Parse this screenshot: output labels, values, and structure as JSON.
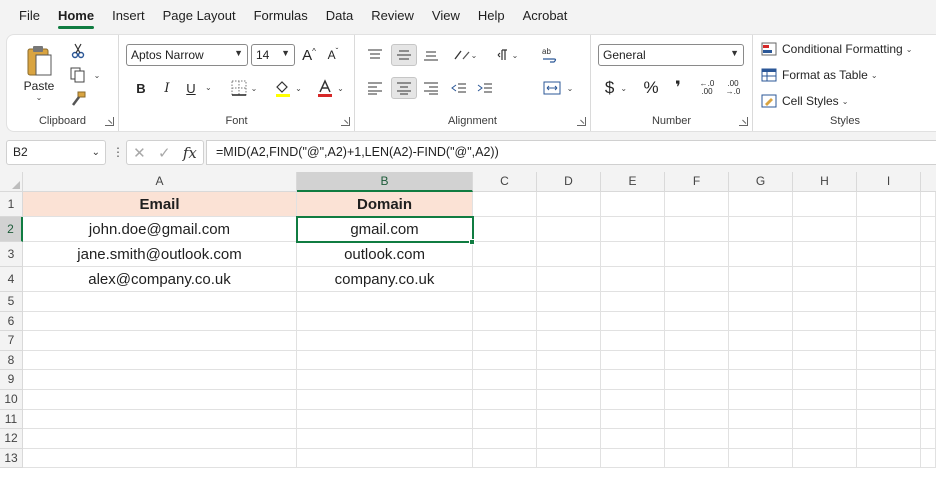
{
  "menu": {
    "tabs": [
      "File",
      "Home",
      "Insert",
      "Page Layout",
      "Formulas",
      "Data",
      "Review",
      "View",
      "Help",
      "Acrobat"
    ],
    "active": "Home"
  },
  "ribbon": {
    "clipboard": {
      "label": "Clipboard",
      "paste": "Paste"
    },
    "font": {
      "label": "Font",
      "name": "Aptos Narrow",
      "size": "14",
      "bold": "B",
      "italic": "I",
      "underline": "U",
      "grow": "A",
      "shrink": "A"
    },
    "alignment": {
      "label": "Alignment"
    },
    "number": {
      "label": "Number",
      "format": "General",
      "currency": "$",
      "percent": "%",
      "comma": "❜",
      "inc_decimal": "←.0 .00",
      "dec_decimal": ".00 →.0"
    },
    "styles": {
      "label": "Styles",
      "conditional": "Conditional Formatting",
      "format_table": "Format as Table",
      "cell_styles": "Cell Styles"
    }
  },
  "formula_bar": {
    "name_box": "B2",
    "formula": "=MID(A2,FIND(\"@\",A2)+1,LEN(A2)-FIND(\"@\",A2))"
  },
  "sheet": {
    "columns": [
      "A",
      "B",
      "C",
      "D",
      "E",
      "F",
      "G",
      "H",
      "I"
    ],
    "rows": [
      "1",
      "2",
      "3",
      "4",
      "5",
      "6",
      "7",
      "8",
      "9",
      "10",
      "11",
      "12",
      "13"
    ],
    "selected_cell": "B2",
    "cells": {
      "A1": "Email",
      "B1": "Domain",
      "A2": "john.doe@gmail.com",
      "B2": "gmail.com",
      "A3": "jane.smith@outlook.com",
      "B3": "outlook.com",
      "A4": "alex@company.co.uk",
      "B4": "company.co.uk"
    },
    "header_fill": "#fbe2d5",
    "accent": "#107c41"
  }
}
